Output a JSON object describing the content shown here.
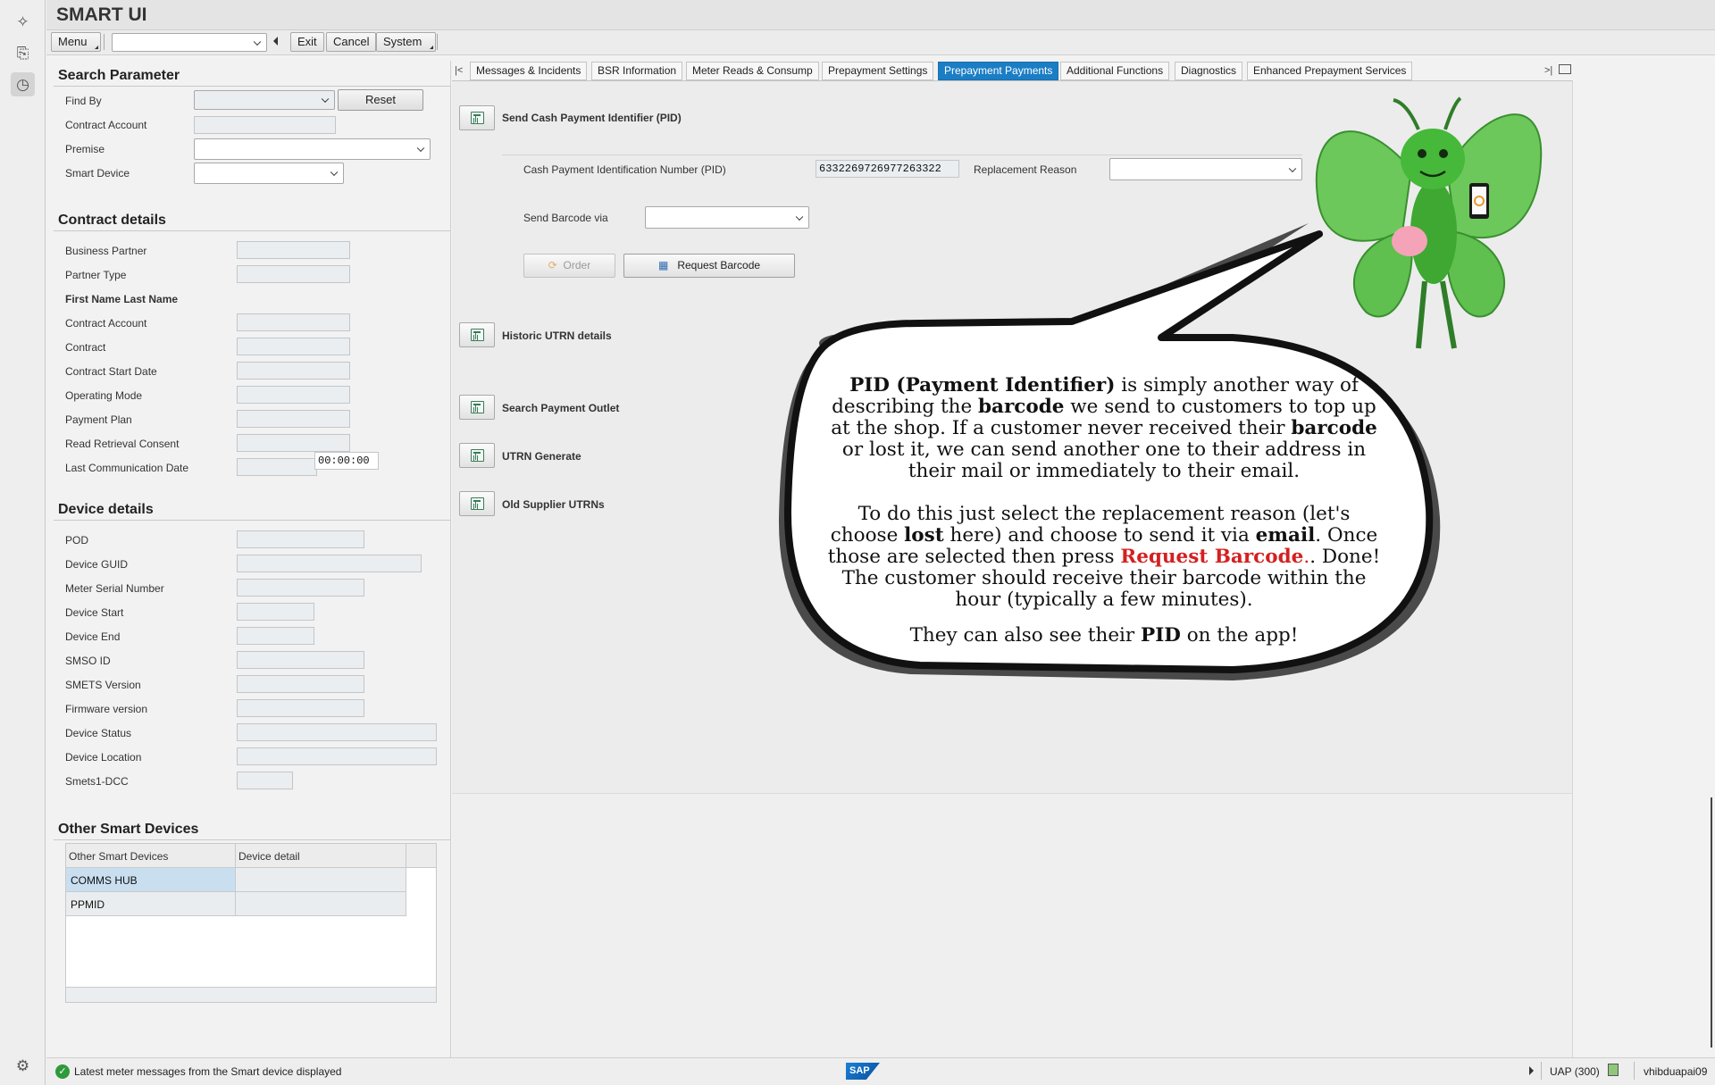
{
  "app_title": "SMART UI",
  "toolbar": {
    "menu_label": "Menu",
    "exit_label": "Exit",
    "cancel_label": "Cancel",
    "system_label": "System"
  },
  "search": {
    "title": "Search Parameter",
    "find_by_label": "Find By",
    "reset_label": "Reset",
    "contract_account_label": "Contract Account",
    "premise_label": "Premise",
    "smart_device_label": "Smart Device"
  },
  "contract": {
    "title": "Contract details",
    "fields": [
      "Business Partner",
      "Partner Type",
      "First Name Last Name",
      "Contract Account",
      "Contract",
      "Contract Start Date",
      "Operating Mode",
      "Payment Plan",
      "Read Retrieval Consent",
      "Last Communication Date"
    ],
    "time_value": "00:00:00"
  },
  "device": {
    "title": "Device details",
    "fields": [
      "POD",
      "Device GUID",
      "Meter Serial Number",
      "Device Start",
      "Device End",
      "SMSO ID",
      "SMETS Version",
      "Firmware version",
      "Device Status",
      "Device Location",
      "Smets1-DCC"
    ]
  },
  "other_devices": {
    "title": "Other Smart Devices",
    "columns": [
      "Other Smart Devices",
      "Device detail"
    ],
    "rows": [
      "COMMS HUB",
      "PPMID"
    ]
  },
  "tabs": [
    "Messages & Incidents",
    "BSR Information",
    "Meter Reads & Consump",
    "Prepayment Settings",
    "Prepayment Payments",
    "Additional Functions",
    "Diagnostics",
    "Enhanced Prepayment Services"
  ],
  "active_tab": "Prepayment Payments",
  "pid": {
    "section_title": "Send Cash Payment Identifier (PID)",
    "pid_label": "Cash Payment Identification Number (PID)",
    "pid_value": "6332269726977263322",
    "replacement_reason_label": "Replacement Reason",
    "send_barcode_label": "Send Barcode via",
    "order_label": "Order",
    "request_barcode_label": "Request Barcode"
  },
  "sections": [
    "Historic UTRN details",
    "Search Payment Outlet",
    "UTRN Generate",
    "Old Supplier UTRNs"
  ],
  "bubble": {
    "p1_a": "PID (Payment Identifier)",
    "p1_b": " is simply another way of describing the ",
    "p1_c": "barcode",
    "p1_d": " we send to customers to top up at the shop. If a customer never received their ",
    "p1_e": "barcode",
    "p1_f": " or lost it, we can send another one to their address in their mail or immediately to their email.",
    "p2_a": "To do this just select the replacement reason (let's choose ",
    "p2_b": "lost",
    "p2_c": " here) and choose to send it via ",
    "p2_d": "email",
    "p2_e": ". Once those are selected then press ",
    "p2_f": "Request Barcode",
    "p2_g": ". Done! The customer should receive their barcode within the hour (typically a few minutes).",
    "p3_a": "They can also see their ",
    "p3_b": "PID",
    "p3_c": " on the app!"
  },
  "status": {
    "message": "Latest meter messages from the Smart device displayed",
    "sap_logo": "SAP",
    "system": "UAP (300)",
    "user": "vhibduapai09"
  },
  "colors": {
    "active_tab": "#1b7ec5",
    "highlight_red": "#d42020",
    "mascot_green": "#3fae3a"
  }
}
